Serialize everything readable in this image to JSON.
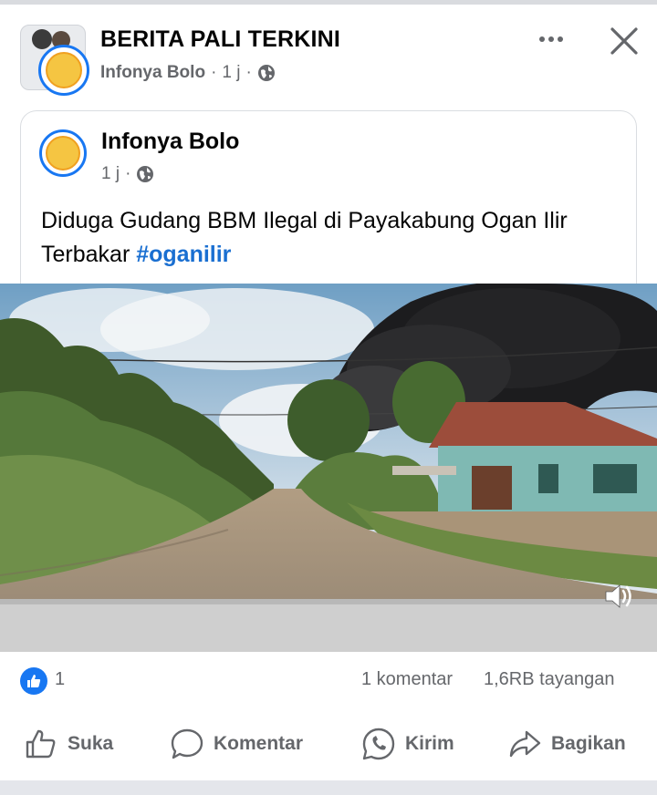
{
  "header": {
    "page_name": "BERITA PALI TERKINI",
    "author": "Infonya Bolo",
    "time": "1 j",
    "separator": "·"
  },
  "shared_post": {
    "author": "Infonya Bolo",
    "time": "1 j",
    "separator": "·",
    "text": "Diduga Gudang BBM Ilegal di Payakabung Ogan Ilir Terbakar ",
    "hashtag": "#oganilir"
  },
  "stats": {
    "likes": "1",
    "comments": "1 komentar",
    "views": "1,6RB tayangan"
  },
  "actions": {
    "like": "Suka",
    "comment": "Komentar",
    "send": "Kirim",
    "share": "Bagikan"
  },
  "icons": {
    "more": "more-horizontal-icon",
    "close": "close-icon",
    "privacy": "globe-icon",
    "audio": "speaker-icon",
    "like_reaction": "thumbs-up-icon"
  },
  "colors": {
    "accent": "#1877f2",
    "hashtag": "#1a6fd1",
    "secondary_text": "#65676b"
  }
}
